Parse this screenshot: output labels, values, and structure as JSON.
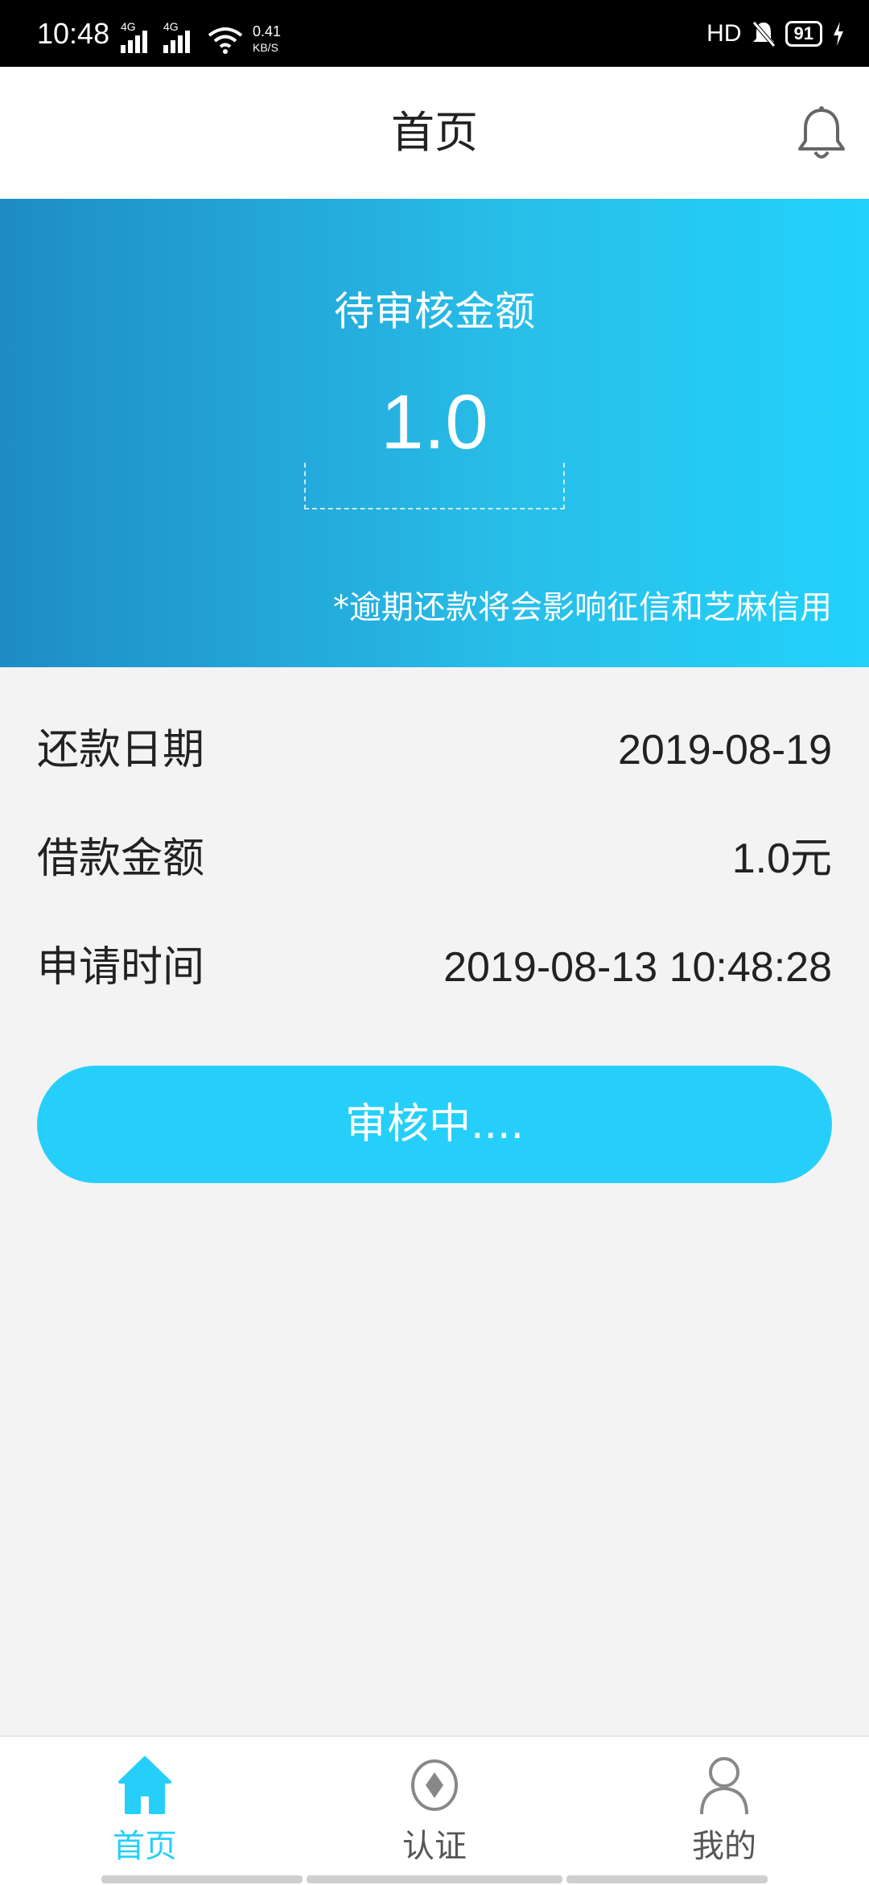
{
  "status_bar": {
    "time": "10:48",
    "network_a": "4G",
    "network_b": "4G",
    "speed_value": "0.41",
    "speed_unit": "KB/S",
    "hd": "HD",
    "battery": "91"
  },
  "header": {
    "title": "首页",
    "bell_icon": "bell-icon"
  },
  "banner": {
    "label": "待审核金额",
    "amount": "1.0",
    "note": "*逾期还款将会影响征信和芝麻信用"
  },
  "details": [
    {
      "key": "还款日期",
      "value": "2019-08-19"
    },
    {
      "key": "借款金额",
      "value": "1.0元"
    },
    {
      "key": "申请时间",
      "value": "2019-08-13 10:48:28"
    }
  ],
  "status_button": {
    "label": "审核中...."
  },
  "bottom_nav": {
    "items": [
      {
        "label": "首页",
        "icon": "home-icon",
        "active": true
      },
      {
        "label": "认证",
        "icon": "certify-icon",
        "active": false
      },
      {
        "label": "我的",
        "icon": "user-icon",
        "active": false
      }
    ]
  },
  "colors": {
    "accent": "#26cffa",
    "banner_start": "#1e8cc6",
    "banner_end": "#22d2fb",
    "inactive": "#555555"
  }
}
